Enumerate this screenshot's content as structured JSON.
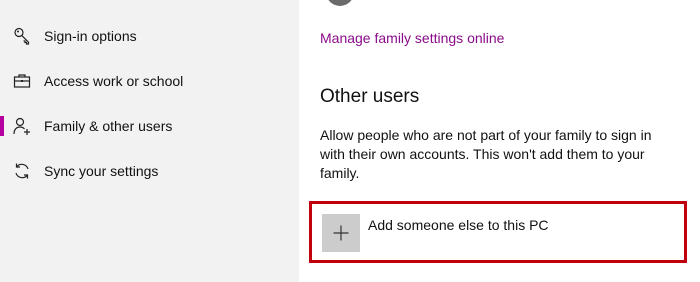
{
  "sidebar": {
    "items": [
      {
        "label": "Sign-in options",
        "icon": "key-icon",
        "selected": false
      },
      {
        "label": "Access work or school",
        "icon": "briefcase-icon",
        "selected": false
      },
      {
        "label": "Family & other users",
        "icon": "person-add-icon",
        "selected": true
      },
      {
        "label": "Sync your settings",
        "icon": "sync-icon",
        "selected": false
      }
    ]
  },
  "main": {
    "family_link": "Manage family settings online",
    "other_users": {
      "title": "Other users",
      "description": "Allow people who are not part of your family to sign in with their own accounts. This won't add them to your family.",
      "add_button_label": "Add someone else to this PC"
    }
  },
  "colors": {
    "accent": "#b4009e",
    "link": "#8a0c8a",
    "highlight_border": "#c0000c",
    "sidebar_bg": "#f2f2f2"
  }
}
